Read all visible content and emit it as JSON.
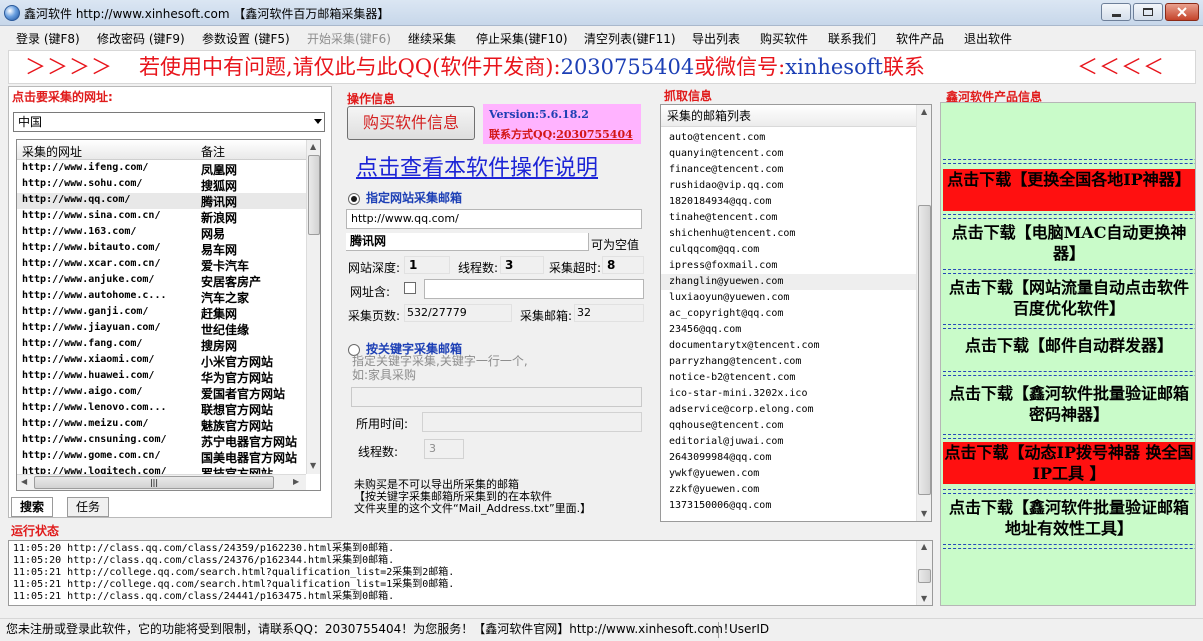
{
  "window": {
    "title": "鑫河软件 http://www.xinhesoft.com 【鑫河软件百万邮箱采集器】"
  },
  "menu": [
    {
      "label": "登录 (键F8)",
      "disabled": false
    },
    {
      "label": "修改密码 (键F9)",
      "disabled": false
    },
    {
      "label": "参数设置 (键F5)",
      "disabled": false
    },
    {
      "label": "开始采集(键F6)",
      "disabled": true
    },
    {
      "label": "继续采集",
      "disabled": false
    },
    {
      "label": "停止采集(键F10)",
      "disabled": false
    },
    {
      "label": "清空列表(键F11)",
      "disabled": false
    },
    {
      "label": "导出列表",
      "disabled": false
    },
    {
      "label": "购买软件",
      "disabled": false
    },
    {
      "label": "联系我们",
      "disabled": false
    },
    {
      "label": "软件产品",
      "disabled": false
    },
    {
      "label": "退出软件",
      "disabled": false
    }
  ],
  "banner": {
    "arrows_left": "＞＞＞＞",
    "text_red": "若使用中有问题,请仅此与此QQ(软件开发商):",
    "qq": "2030755404",
    "text_or": "或微信号:",
    "wechat": "xinhesoft",
    "text_end": "联系",
    "arrows_right": "＜＜＜＜"
  },
  "left": {
    "heading": "点击要采集的网址:",
    "country": "中国",
    "col_url": "采集的网址",
    "col_note": "备注",
    "selected_index": 3,
    "rows": [
      {
        "url": "http://www.ifeng.com/",
        "name": "凤凰网"
      },
      {
        "url": "http://www.sohu.com/",
        "name": "搜狐网"
      },
      {
        "url": "http://www.qq.com/",
        "name": "腾讯网"
      },
      {
        "url": "http://www.sina.com.cn/",
        "name": "新浪网"
      },
      {
        "url": "http://www.163.com/",
        "name": "网易"
      },
      {
        "url": "http://www.bitauto.com/",
        "name": "易车网"
      },
      {
        "url": "http://www.xcar.com.cn/",
        "name": "爱卡汽车"
      },
      {
        "url": "http://www.anjuke.com/",
        "name": "安居客房产"
      },
      {
        "url": "http://www.autohome.c...",
        "name": "汽车之家"
      },
      {
        "url": "http://www.ganji.com/",
        "name": "赶集网"
      },
      {
        "url": "http://www.jiayuan.com/",
        "name": "世纪佳缘"
      },
      {
        "url": "http://www.fang.com/",
        "name": "搜房网"
      },
      {
        "url": "http://www.xiaomi.com/",
        "name": "小米官方网站"
      },
      {
        "url": "http://www.huawei.com/",
        "name": "华为官方网站"
      },
      {
        "url": "http://www.aigo.com/",
        "name": "爱国者官方网站"
      },
      {
        "url": "http://www.lenovo.com...",
        "name": "联想官方网站"
      },
      {
        "url": "http://www.meizu.com/",
        "name": "魅族官方网站"
      },
      {
        "url": "http://www.cnsuning.com/",
        "name": "苏宁电器官方网站"
      },
      {
        "url": "http://www.gome.com.cn/",
        "name": "国美电器官方网站"
      },
      {
        "url": "http://www.logitech.com/",
        "name": "罗技官方网站"
      }
    ],
    "tabs": [
      "搜索",
      "任务"
    ]
  },
  "mid": {
    "heading": "操作信息",
    "buy_label": "购买软件信息",
    "version": "Version:5.6.18.2",
    "contact_label": "联系方式QQ:",
    "contact_qq": "2030755404",
    "help_link": "点击查看本软件操作说明",
    "radio_site": "指定网站采集邮箱",
    "site_url": "http://www.qq.com/",
    "site_name": "腾讯网",
    "optional": "可为空值",
    "depth_label": "网站深度:",
    "depth_value": "1",
    "threads_label": "线程数:",
    "threads_value": "3",
    "timeout_label": "采集超时:",
    "timeout_value": "8",
    "url_contains_label": "网址含:",
    "pages_label": "采集页数:",
    "pages_value": "532/27779",
    "emails_label": "采集邮箱:",
    "emails_value": "32",
    "radio_kw": "按关键字采集邮箱",
    "kw_hint1": "指定关键字采集,关键字一行一个,",
    "kw_hint2": "如:家具采购",
    "used_time_label": "所用时间:",
    "kw_threads_label": "线程数:",
    "kw_threads_value": "3",
    "notice1": "未购买是不可以导出所采集的邮箱",
    "notice2": "【按关键字采集邮箱所采集到的在本软件",
    "notice3": "文件夹里的这个文件“Mail_Address.txt”里面.】"
  },
  "emails": {
    "heading": "抓取信息",
    "list_header": "采集的邮箱列表",
    "items": [
      "auto@tencent.com",
      "quanyin@tencent.com",
      "finance@tencent.com",
      "rushidao@vip.qq.com",
      "1820184934@qq.com",
      "tinahe@tencent.com",
      "shichenhu@tencent.com",
      "culqqcom@qq.com",
      "ipress@foxmail.com",
      "zhanglin@yuewen.com",
      "luxiaoyun@yuewen.com",
      "ac_copyright@qq.com",
      "23456@qq.com",
      "documentarytx@tencent.com",
      "parryzhang@tencent.com",
      "notice-b2@tencent.com",
      "ico-star-mini.3202x.ico",
      "adservice@corp.elong.com",
      "qqhouse@tencent.com",
      "editorial@juwai.com",
      "2643099984@qq.com",
      "ywkf@yuewen.com",
      "zzkf@yuewen.com",
      "1373150006@qq.com"
    ],
    "selected_index": 9
  },
  "products": {
    "heading": "鑫河软件产品信息",
    "items": [
      {
        "label": "点击下载【更换全国各地IP神器】",
        "red": true
      },
      {
        "label": "点击下载【电脑MAC自动更换神器】",
        "red": false
      },
      {
        "label": "点击下载【网站流量自动点击软件 百度优化软件】",
        "red": false
      },
      {
        "label": "点击下载【邮件自动群发器】",
        "red": false
      },
      {
        "label": "点击下载【鑫河软件批量验证邮箱密码神器】",
        "red": false
      },
      {
        "label": "点击下载【动态IP拨号神器 换全国IP工具 】",
        "red": true
      },
      {
        "label": "点击下载【鑫河软件批量验证邮箱地址有效性工具】",
        "red": false
      }
    ]
  },
  "log": {
    "heading": "运行状态",
    "lines": [
      "11:05:20 http://class.qq.com/class/24359/p162230.html采集到0邮箱.",
      "11:05:20 http://class.qq.com/class/24376/p162344.html采集到0邮箱.",
      "11:05:21 http://college.qq.com/search.html?qualification_list=2采集到2邮箱.",
      "11:05:21 http://college.qq.com/search.html?qualification_list=1采集到0邮箱.",
      "11:05:21 http://class.qq.com/class/24441/p163475.html采集到0邮箱."
    ]
  },
  "status": {
    "text": "您未注册或登录此软件，它的功能将受到限制，请联系QQ：2030755404！为您服务！【鑫河软件官网】http://www.xinhesoft.com！",
    "user": "UserID"
  },
  "colors": {
    "accent_red": "#e01b1b",
    "link_blue": "#1c24d6",
    "product_bg": "#c9fbc9",
    "version_bg": "#ffb3ff"
  }
}
